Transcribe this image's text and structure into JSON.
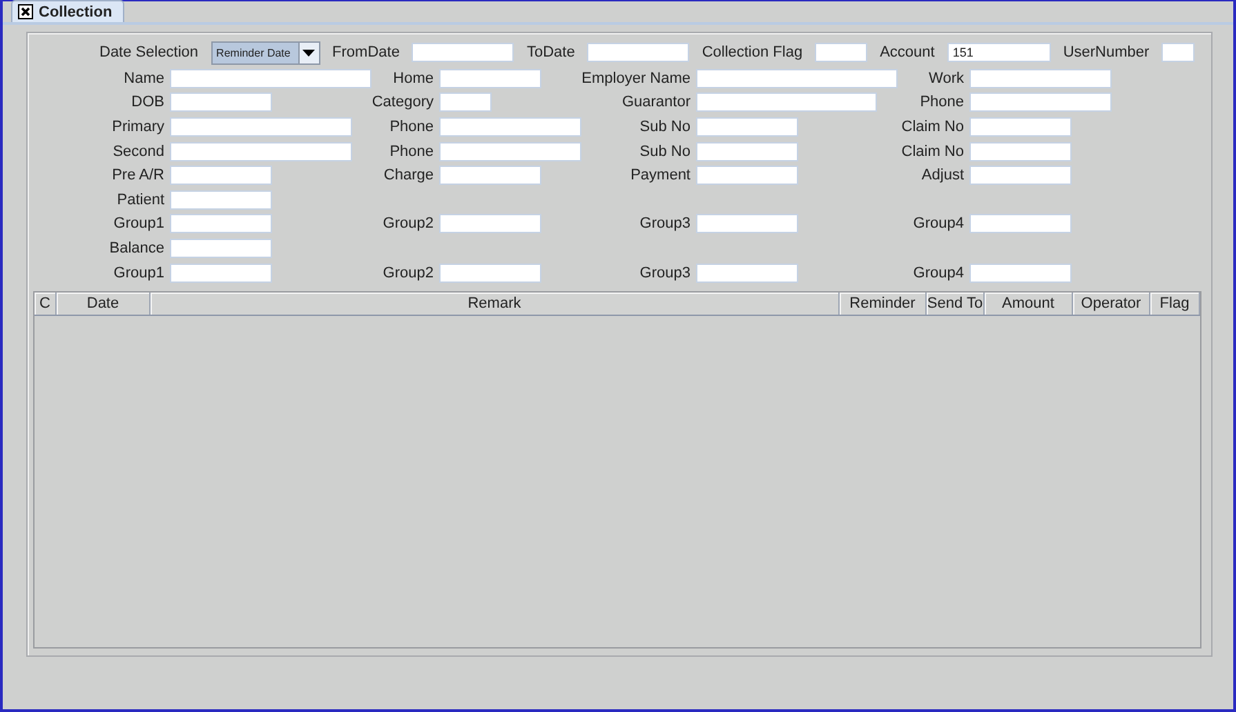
{
  "tab": {
    "label": "Collection",
    "selected": true
  },
  "top_bar": {
    "date_selection": {
      "label": "Date Selection",
      "value": "Reminder Date"
    },
    "fields": [
      {
        "label": "FromDate"
      },
      {
        "label": "ToDate"
      },
      {
        "label": "Collection Flag"
      },
      {
        "label": "Account",
        "value": "151"
      },
      {
        "label": "UserNumber"
      }
    ]
  },
  "form_rows": [
    [
      {
        "label": "Name"
      },
      {
        "label": "Home"
      },
      {
        "label": "Employer Name"
      },
      {
        "label": "Work"
      }
    ],
    [
      {
        "label": "DOB"
      },
      {
        "label": "Category"
      },
      {
        "label": "Guarantor"
      },
      {
        "label": "Phone"
      }
    ],
    [
      {
        "label": "Primary"
      },
      {
        "label": "Phone"
      },
      {
        "label": "Sub No"
      },
      {
        "label": "Claim No"
      }
    ],
    [
      {
        "label": "Second"
      },
      {
        "label": "Phone"
      },
      {
        "label": "Sub No"
      },
      {
        "label": "Claim No"
      }
    ],
    [
      {
        "label": "Pre A/R"
      },
      {
        "label": "Charge"
      },
      {
        "label": "Payment"
      },
      {
        "label": "Adjust"
      }
    ],
    [
      {
        "label": "Patient"
      }
    ],
    [
      {
        "label": "Group1"
      },
      {
        "label": "Group2"
      },
      {
        "label": "Group3"
      },
      {
        "label": "Group4"
      }
    ],
    [
      {
        "label": "Balance"
      }
    ],
    [
      {
        "label": "Group1"
      },
      {
        "label": "Group2"
      },
      {
        "label": "Group3"
      },
      {
        "label": "Group4"
      }
    ]
  ],
  "table": {
    "columns": [
      "C",
      "Date",
      "Remark",
      "Reminder",
      "Send To",
      "Amount",
      "Operator",
      "Flag"
    ]
  }
}
